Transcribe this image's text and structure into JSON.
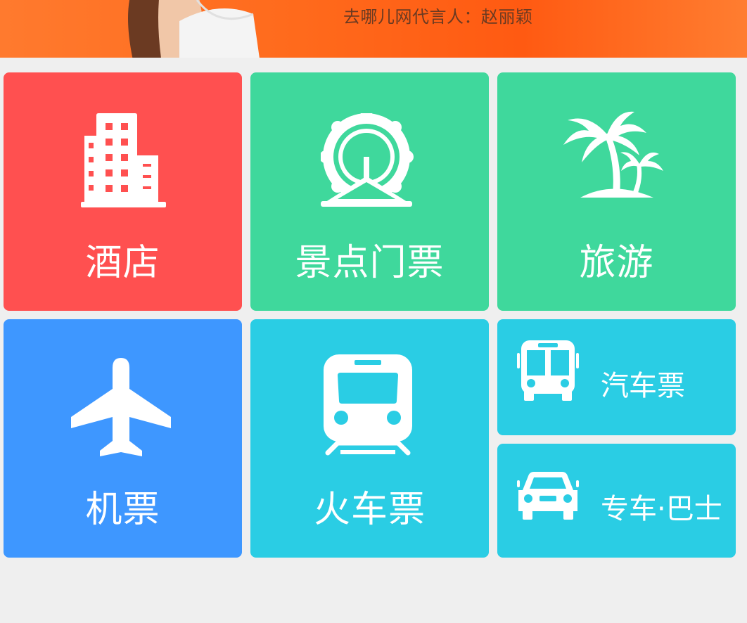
{
  "banner": {
    "caption": "去哪儿网代言人：赵丽颖"
  },
  "tiles": {
    "hotel": {
      "label": "酒店",
      "color": "#ff5050",
      "icon": "building-icon"
    },
    "scenic": {
      "label": "景点门票",
      "color": "#3fd89c",
      "icon": "ferris-wheel-icon"
    },
    "travel": {
      "label": "旅游",
      "color": "#3fd89c",
      "icon": "palm-tree-icon"
    },
    "flight": {
      "label": "机票",
      "color": "#3e97ff",
      "icon": "airplane-icon"
    },
    "train": {
      "label": "火车票",
      "color": "#2acde4",
      "icon": "train-icon"
    },
    "bus": {
      "label": "汽车票",
      "color": "#2acde4",
      "icon": "bus-icon"
    },
    "car": {
      "label": "专车·巴士",
      "color": "#2acde4",
      "icon": "car-icon"
    }
  }
}
